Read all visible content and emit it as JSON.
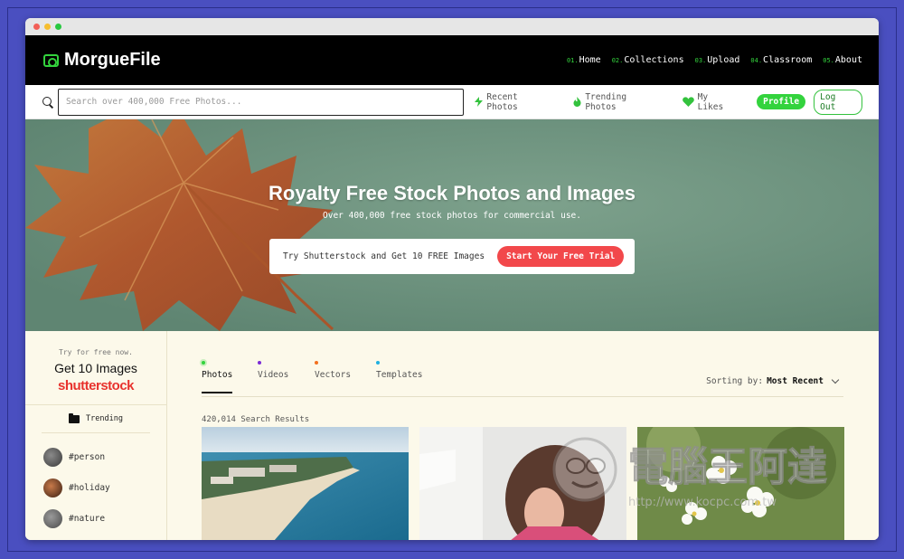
{
  "browser": {
    "title": ""
  },
  "brand": {
    "name": "MorgueFile"
  },
  "nav": [
    {
      "num": "01.",
      "label": "Home"
    },
    {
      "num": "02.",
      "label": "Collections"
    },
    {
      "num": "03.",
      "label": "Upload"
    },
    {
      "num": "04.",
      "label": "Classroom"
    },
    {
      "num": "05.",
      "label": "About"
    }
  ],
  "search": {
    "placeholder": "Search over 400,000 Free Photos...",
    "value": ""
  },
  "quick_links": {
    "recent": "Recent Photos",
    "trending": "Trending Photos",
    "likes": "My Likes",
    "profile": "Profile",
    "logout": "Log Out"
  },
  "hero": {
    "title": "Royalty Free Stock Photos and Images",
    "subtitle": "Over 400,000 free stock photos for commercial use.",
    "cta_text": "Try Shutterstock and Get 10 FREE Images",
    "cta_button": "Start Your Free Trial"
  },
  "sidebar": {
    "promo_small": "Try for free now.",
    "promo_big": "Get 10 Images",
    "promo_brand": "shutterstock",
    "trending_label": "Trending",
    "tags": [
      "#person",
      "#holiday",
      "#nature"
    ]
  },
  "tabs": [
    {
      "label": "Photos",
      "color": "#33d33d"
    },
    {
      "label": "Videos",
      "color": "#7a2bd6"
    },
    {
      "label": "Vectors",
      "color": "#f2701f"
    },
    {
      "label": "Templates",
      "color": "#1fb0e0"
    }
  ],
  "sorting": {
    "label": "Sorting by:",
    "value": "Most Recent"
  },
  "results": {
    "count_text": "420,014 Search Results"
  },
  "watermark": {
    "text": "電腦王阿達",
    "url": "http://www.kocpc.com.tw"
  },
  "colors": {
    "accent": "#33d33d",
    "cta": "#f2484b",
    "hero_bg": "#6f9580",
    "lower_bg": "#fcf9ea"
  }
}
